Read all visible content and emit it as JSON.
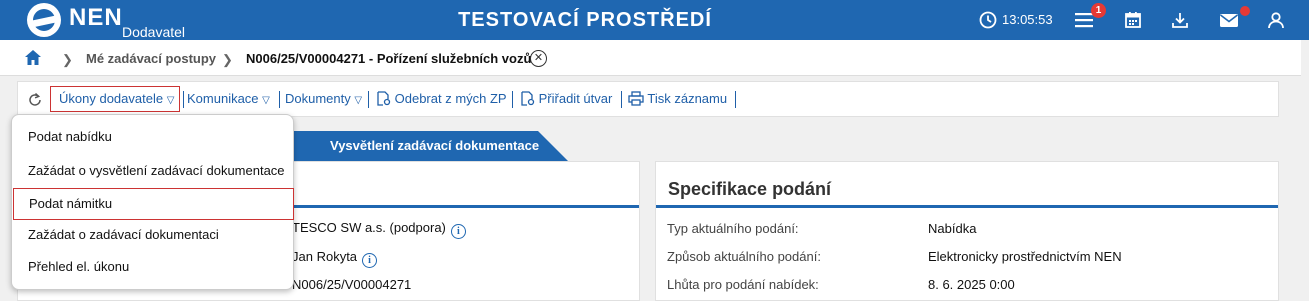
{
  "header": {
    "brand": "NEN",
    "brand_sub": "Dodavatel",
    "environment": "TESTOVACÍ PROSTŘEDÍ",
    "time": "13:05:53",
    "notification_count": "1",
    "colors": {
      "bar": "#1f67b1",
      "badge": "#e53935"
    }
  },
  "breadcrumb": {
    "items": [
      "Mé zadávací postupy",
      "N006/25/V00004271 - Pořízení služebních vozů"
    ]
  },
  "toolbar": {
    "actions": [
      "Úkony dodavatele",
      "Komunikace",
      "Dokumenty",
      "Odebrat z mých ZP",
      "Přiřadit útvar",
      "Tisk záznamu"
    ]
  },
  "tabs": {
    "active": "Vysvětlení zadávací dokumentace"
  },
  "dropdown": {
    "items": [
      "Podat nabídku",
      "Zažádat o vysvětlení zadávací dokumentace",
      "Podat námitku",
      "Zažádat o zadávací dokumentaci",
      "Přehled el. úkonu"
    ]
  },
  "left_panel": {
    "values": [
      "TESCO SW a.s. (podpora)",
      "Jan Rokyta",
      "N006/25/V00004271"
    ]
  },
  "right_panel": {
    "title": "Specifikace podání",
    "rows": [
      {
        "label": "Typ aktuálního podání:",
        "value": "Nabídka"
      },
      {
        "label": "Způsob aktuálního podání:",
        "value": "Elektronicky prostřednictvím NEN"
      },
      {
        "label": "Lhůta pro podání nabídek:",
        "value": "8. 6. 2025 0:00"
      }
    ]
  }
}
